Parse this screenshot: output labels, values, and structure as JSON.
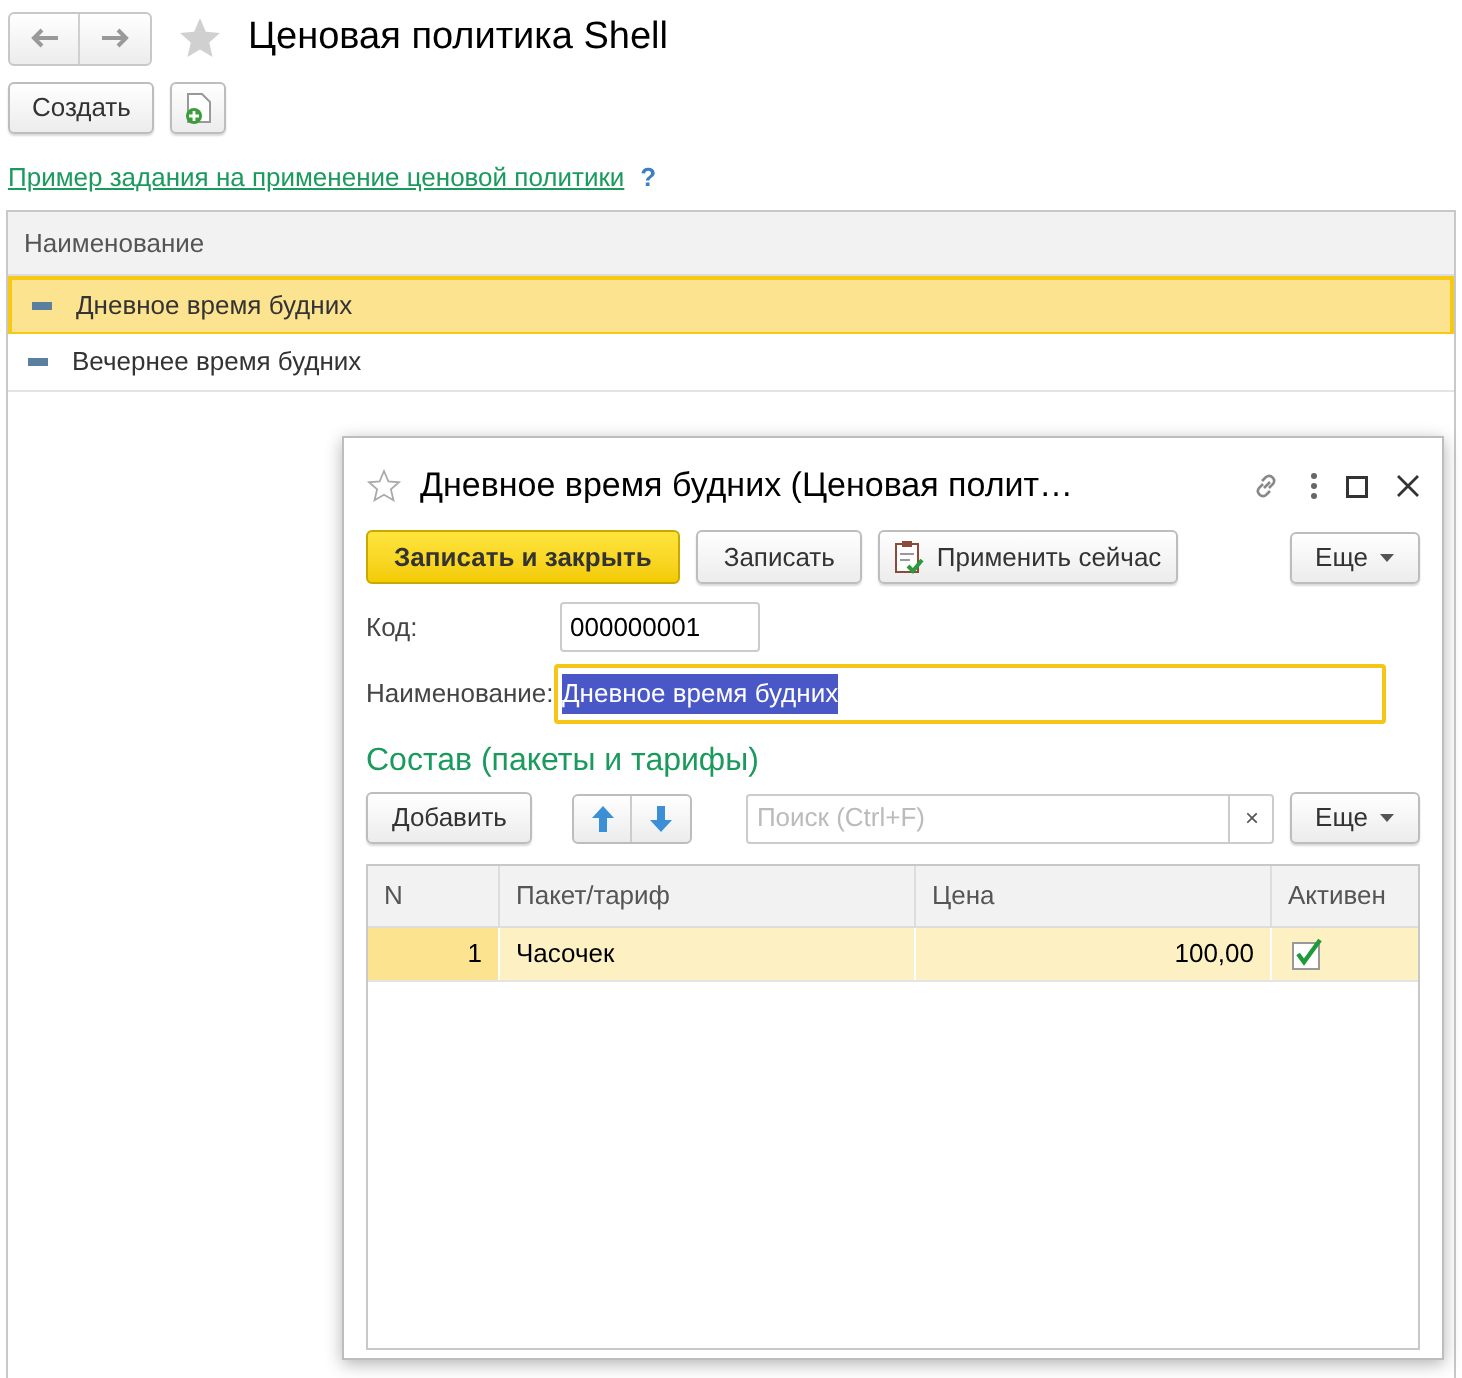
{
  "window": {
    "title": "Ценовая политика Shell",
    "favorite": false
  },
  "toolbar": {
    "create_button": "Создать"
  },
  "help_link": {
    "text": "Пример задания на применение ценовой политики",
    "help_mark": "?"
  },
  "list": {
    "columns": [
      "Наименование"
    ],
    "rows": [
      {
        "name": "Дневное время будних",
        "selected": true
      },
      {
        "name": "Вечернее время будних",
        "selected": false
      }
    ]
  },
  "dialog": {
    "title": "Дневное время будних (Ценовая полит…",
    "favorite": false,
    "buttons": [
      {
        "label": "Записать и закрыть",
        "kind": "primary"
      },
      {
        "label": "Записать",
        "kind": "plain"
      },
      {
        "label": "Применить сейчас",
        "kind": "apply"
      }
    ],
    "more_button": "Еще",
    "fields": [
      {
        "label": "Код:",
        "value": "000000001",
        "focused": false
      },
      {
        "label": "Наименование:",
        "value": "Дневное время будних",
        "focused": true
      }
    ],
    "section_title": "Состав (пакеты и тарифы)",
    "add_button": "Добавить",
    "search": {
      "placeholder": "Поиск (Ctrl+F)",
      "clear": "×"
    },
    "table_more_button": "Еще",
    "table": {
      "columns": [
        "N",
        "Пакет/тариф",
        "Цена",
        "Активен"
      ],
      "rows": [
        {
          "n": "1",
          "name": "Часочек",
          "price": "100,00",
          "active": true,
          "selected": true
        }
      ]
    }
  }
}
